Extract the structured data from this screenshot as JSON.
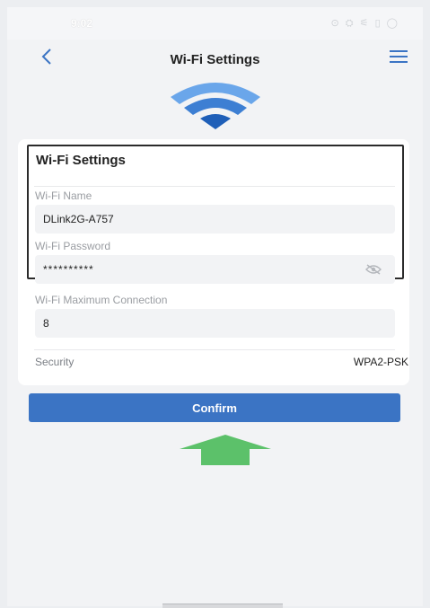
{
  "status_bar": {
    "time": "9:02",
    "icons_text": "⊙ ⛭ ⚟ ▯ ◯"
  },
  "nav": {
    "title": "Wi-Fi Settings",
    "back_icon": "chevron-left-icon",
    "menu_icon": "hamburger-menu-icon"
  },
  "section": {
    "title": "Wi-Fi Settings",
    "wifi_name_label": "Wi-Fi Name",
    "wifi_name_value": "DLink2G-A757",
    "wifi_password_label": "Wi-Fi Password",
    "wifi_password_value": "**********",
    "max_conn_label": "Wi-Fi Maximum Connection",
    "max_conn_value": "8",
    "security_label": "Security",
    "security_value": "WPA2-PSK"
  },
  "confirm_label": "Confirm",
  "colors": {
    "accent": "#3b74c4",
    "wifi_icon": "#3d7fd3",
    "arrow": "#5cc16a"
  }
}
